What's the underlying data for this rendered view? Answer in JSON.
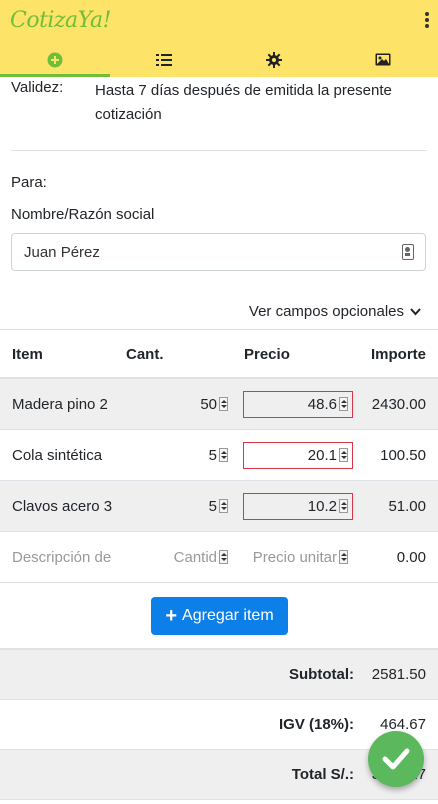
{
  "app": {
    "title": "CotizaYa!"
  },
  "tabs": [
    {
      "icon": "plus-circle-icon",
      "active": true
    },
    {
      "icon": "list-icon",
      "active": false
    },
    {
      "icon": "gear-icon",
      "active": false
    },
    {
      "icon": "image-icon",
      "active": false
    }
  ],
  "validez": {
    "label": "Validez:",
    "value": "Hasta 7 días después de emitida la presente cotización"
  },
  "para": {
    "label": "Para:"
  },
  "nombre": {
    "label": "Nombre/Razón social",
    "value": "Juan Pérez"
  },
  "opcionales": {
    "label": "Ver campos opcionales"
  },
  "table": {
    "headers": {
      "item": "Item",
      "cant": "Cant.",
      "precio": "Precio",
      "importe": "Importe"
    },
    "rows": [
      {
        "item": "Madera pino 2",
        "cant": "50",
        "precio": "48.6",
        "importe": "2430.00"
      },
      {
        "item": "Cola sintética",
        "cant": "5",
        "precio": "20.1",
        "importe": "100.50"
      },
      {
        "item": "Clavos acero 3",
        "cant": "5",
        "precio": "10.2",
        "importe": "51.00"
      }
    ],
    "new_row": {
      "item_placeholder": "Descripción de",
      "cant_placeholder": "Cantid",
      "precio_placeholder": "Precio unitar",
      "importe": "0.00"
    }
  },
  "add_button": {
    "label": "Agregar item"
  },
  "totals": {
    "subtotal": {
      "label": "Subtotal:",
      "value": "2581.50"
    },
    "igv": {
      "label": "IGV (18%):",
      "value": "464.67"
    },
    "total": {
      "label": "Total S/.:",
      "value": "3046.17"
    }
  },
  "colors": {
    "appbar": "#fde367",
    "accent": "#6fbe3a",
    "primary": "#0d7fe8",
    "fab": "#5cb85c",
    "invalid": "#dc3545"
  }
}
